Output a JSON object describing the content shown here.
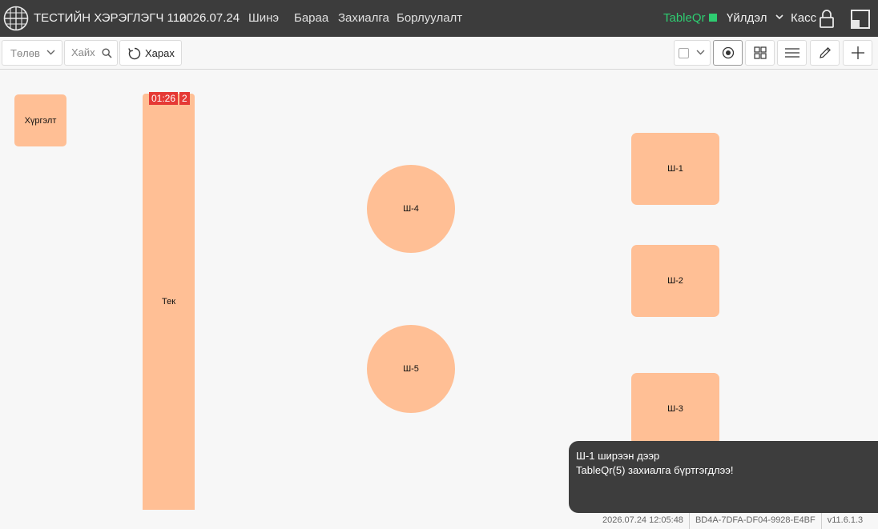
{
  "header": {
    "brand": "ТЕСТИЙН ХЭРЭГЛЭГЧ 110",
    "date": "2026.07.24",
    "nav": [
      {
        "label": "Шинэ"
      },
      {
        "label": "Бараа"
      },
      {
        "label": "Захиалга"
      },
      {
        "label": "Борлуулалт"
      }
    ],
    "tableqr": {
      "label": "TableQr",
      "status_color": "#2ecc71"
    },
    "service_label": "Үйлдэл",
    "cashier_label": "Касс"
  },
  "toolbar": {
    "status_placeholder": "Төлөв",
    "search_placeholder": "Хайх",
    "view_label": "Харах"
  },
  "floor": {
    "tables": [
      {
        "label": "Хүргэлт",
        "shape": "rounded"
      },
      {
        "label": "Тек",
        "shape": "rounded"
      },
      {
        "label": "Ш-4",
        "shape": "circle"
      },
      {
        "label": "Ш-5",
        "shape": "circle"
      },
      {
        "label": "Ш-1",
        "shape": "rounded"
      },
      {
        "label": "Ш-2",
        "shape": "rounded"
      },
      {
        "label": "Ш-3",
        "shape": "rounded"
      }
    ],
    "table_color": "#ffbf95",
    "active_order": {
      "timer": "01:26",
      "count": "2",
      "color": "#e53935"
    }
  },
  "toast": {
    "line1": "Ш-1 ширээн дээр",
    "line2": "TableQr(5) захиалга бүртгэгдлээ!"
  },
  "statusbar": {
    "datetime": "2026.07.24 12:05:48",
    "device_id": "BD4A-7DFA-DF04-9928-E4BF",
    "version": "v11.6.1.3"
  }
}
